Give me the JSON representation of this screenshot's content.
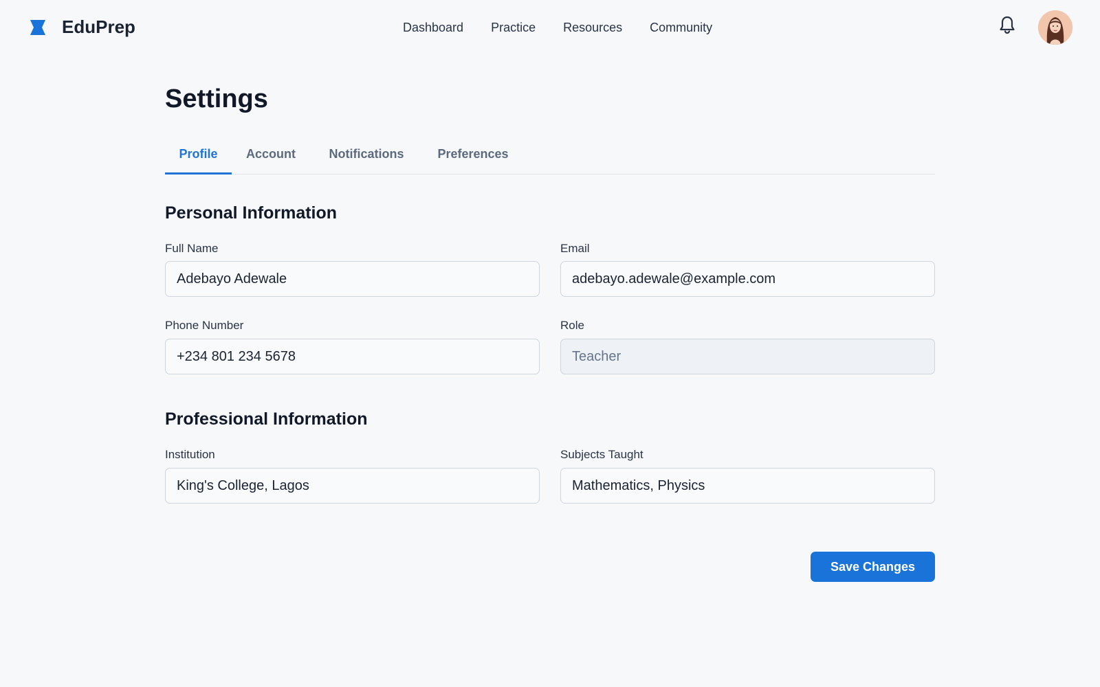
{
  "header": {
    "brand": "EduPrep",
    "brand_color": "#1973d9",
    "nav": [
      {
        "label": "Dashboard"
      },
      {
        "label": "Practice"
      },
      {
        "label": "Resources"
      },
      {
        "label": "Community"
      }
    ],
    "icons": [
      "bell-icon",
      "user-avatar"
    ]
  },
  "page": {
    "title": "Settings",
    "tabs": [
      {
        "label": "Profile",
        "active": true
      },
      {
        "label": "Account",
        "active": false
      },
      {
        "label": "Notifications",
        "active": false
      },
      {
        "label": "Preferences",
        "active": false
      }
    ]
  },
  "personal": {
    "title": "Personal Information",
    "full_name": {
      "label": "Full Name",
      "value": "Adebayo Adewale"
    },
    "email": {
      "label": "Email",
      "value": "adebayo.adewale@example.com"
    },
    "phone": {
      "label": "Phone Number",
      "value": "+234 801 234 5678"
    },
    "role": {
      "label": "Role",
      "value": "Teacher",
      "readonly": true
    }
  },
  "professional": {
    "title": "Professional Information",
    "institution": {
      "label": "Institution",
      "value": "King's College, Lagos"
    },
    "subjects": {
      "label": "Subjects Taught",
      "value": "Mathematics, Physics"
    }
  },
  "actions": {
    "save_label": "Save Changes"
  }
}
